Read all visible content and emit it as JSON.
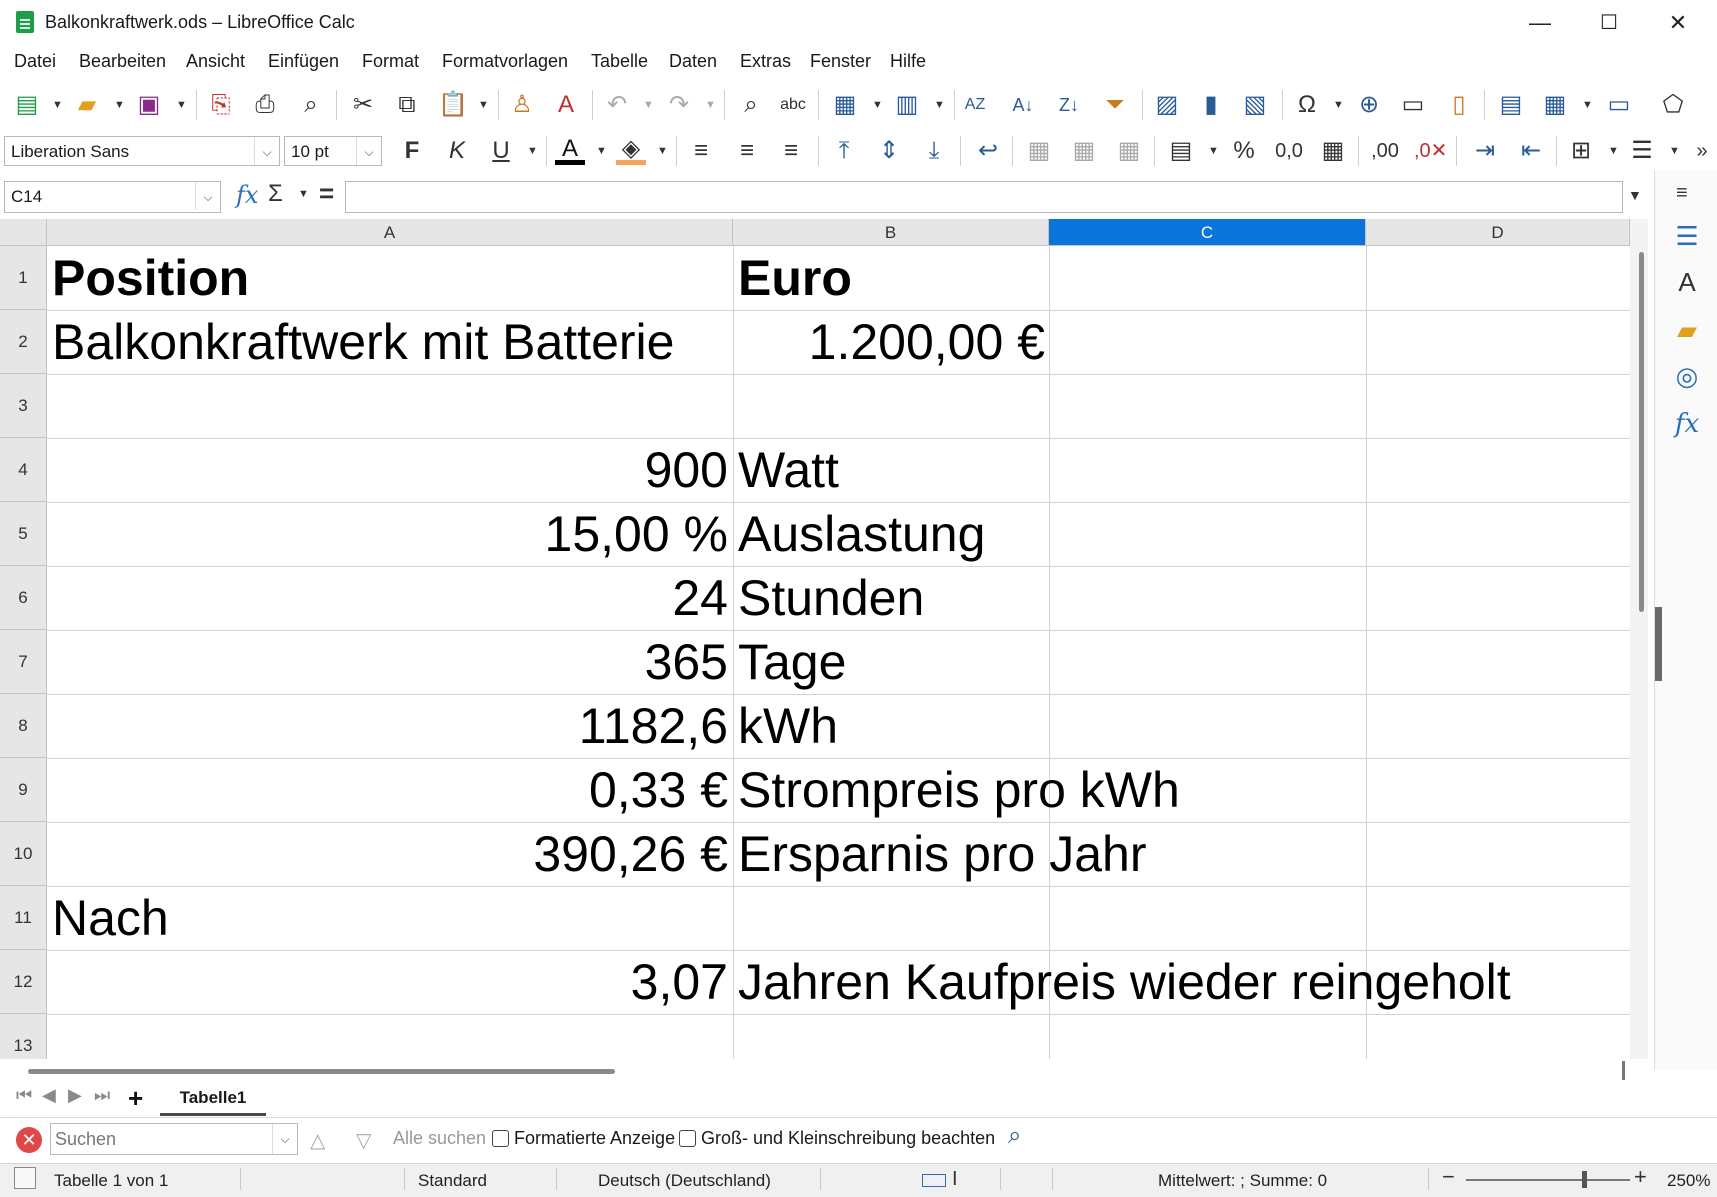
{
  "window": {
    "title": "Balkonkraftwerk.ods – LibreOffice Calc",
    "minimize_icon": "—",
    "maximize_icon": "☐",
    "close_icon": "✕"
  },
  "menu": {
    "items": [
      "Datei",
      "Bearbeiten",
      "Ansicht",
      "Einfügen",
      "Format",
      "Formatvorlagen",
      "Tabelle",
      "Daten",
      "Extras",
      "Fenster",
      "Hilfe"
    ]
  },
  "formatting": {
    "font_name": "Liberation Sans",
    "font_size": "10 pt",
    "bold": "F",
    "italic": "K",
    "underline": "U"
  },
  "formula_bar": {
    "cell_ref": "C14",
    "fx": "fx",
    "sigma": "Σ",
    "equals": "=",
    "content": ""
  },
  "sheet": {
    "columns": [
      "A",
      "B",
      "C",
      "D"
    ],
    "selected_column": "C",
    "rows": [
      "1",
      "2",
      "3",
      "4",
      "5",
      "6",
      "7",
      "8",
      "9",
      "10",
      "11",
      "12",
      "13"
    ],
    "cells": {
      "A1": "Position",
      "B1": "Euro",
      "A2": "Balkonkraftwerk mit Batterie",
      "B2": "1.200,00 €",
      "A4": "900",
      "B4": "Watt",
      "A5": "15,00 %",
      "B5": "Auslastung",
      "A6": "24",
      "B6": "Stunden",
      "A7": "365",
      "B7": "Tage",
      "A8": "1182,6",
      "B8": "kWh",
      "A9": "0,33 €",
      "B9": "Strompreis pro kWh",
      "A10": "390,26 €",
      "B10": "Ersparnis pro Jahr",
      "A11": "Nach",
      "A12": "3,07",
      "B12": "Jahren Kaufpreis wieder reingeholt"
    }
  },
  "tabs": {
    "add": "+",
    "sheet_name": "Tabelle1"
  },
  "find": {
    "placeholder": "Suchen",
    "find_all": "Alle suchen",
    "formatted_display": "Formatierte Anzeige",
    "match_case": "Groß- und Kleinschreibung beachten"
  },
  "status": {
    "sheet_of": "Tabelle 1 von 1",
    "style": "Standard",
    "language": "Deutsch (Deutschland)",
    "selection_summary": "Mittelwert: ; Summe: 0",
    "zoom_label": "250%",
    "zoom_level": 2.5
  },
  "colors": {
    "app_icon": "#1e9e48",
    "selected_header": "#0a74da",
    "icon_blue": "#2a5b96"
  }
}
